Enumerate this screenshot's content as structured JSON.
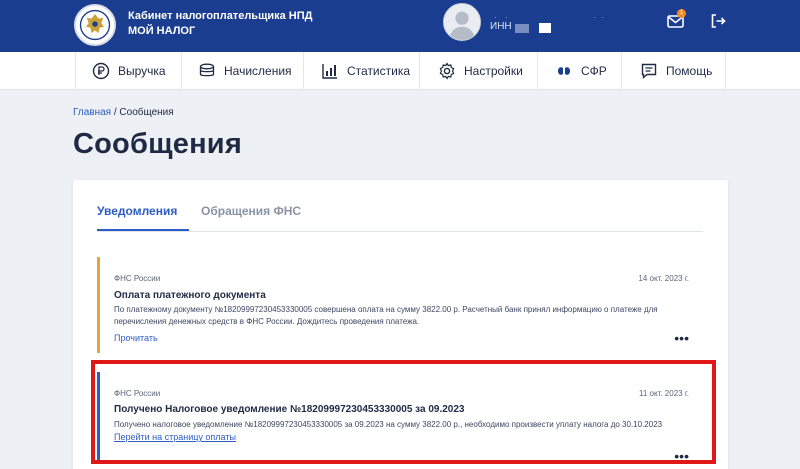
{
  "header": {
    "brand_line1": "Кабинет налогоплательщика НПД",
    "brand_line2": "МОЙ НАЛОГ",
    "inn_label": "ИНН",
    "mail_badge_count": "1",
    "colors": {
      "header_bg": "#1b3d8f",
      "badge": "#f08a24"
    },
    "icons": {
      "emblem": "emblem-icon",
      "avatar": "avatar-icon",
      "mail": "mail-icon",
      "logout": "logout-icon"
    }
  },
  "nav": {
    "items": [
      {
        "label": "Выручка",
        "icon": "ruble-icon"
      },
      {
        "label": "Начисления",
        "icon": "coins-icon"
      },
      {
        "label": "Статистика",
        "icon": "chart-icon"
      },
      {
        "label": "Настройки",
        "icon": "gear-icon"
      },
      {
        "label": "СФР",
        "icon": "sfr-logo-icon"
      },
      {
        "label": "Помощь",
        "icon": "help-chat-icon"
      }
    ]
  },
  "breadcrumb": {
    "home": "Главная",
    "separator": " / ",
    "current": "Сообщения"
  },
  "page_title": "Сообщения",
  "tabs": [
    {
      "label": "Уведомления",
      "active": true
    },
    {
      "label": "Обращения ФНС",
      "active": false
    }
  ],
  "messages": [
    {
      "sender": "ФНС России",
      "date": "14 окт. 2023 г.",
      "title": "Оплата платежного документа",
      "text": "По платежному документу №18209997230453330005 совершена оплата на сумму 3822.00 р. Расчетный банк принял информацию о платеже для перечисления денежных средств в ФНС России. Дождитесь проведения платежа.",
      "link": "Прочитать",
      "accent": "#e8a33d"
    },
    {
      "sender": "ФНС России",
      "date": "11 окт. 2023 г.",
      "title": "Получено Налоговое уведомление №18209997230453330005 за 09.2023",
      "text": "Получено налоговое уведомление №18209997230453330005 за 09.2023 на сумму 3822.00 р., необходимо произвести уплату налога до 30.10.2023",
      "link": "Перейти на страницу оплаты",
      "accent": "#2e5cc5"
    }
  ],
  "more_label": "•••",
  "highlight_color": "#e01818"
}
